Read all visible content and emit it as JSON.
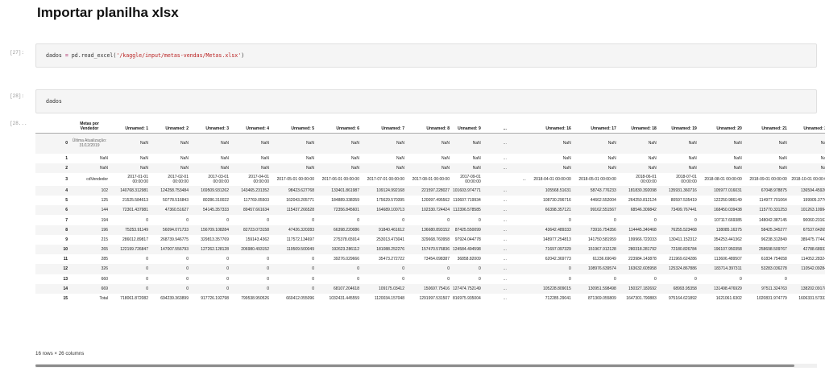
{
  "heading": "Importar planilha xlsx",
  "cells": [
    {
      "prompt": "[27]:",
      "code": {
        "var": "dados",
        "eq": " = ",
        "call": "pd.read_excel(",
        "str": "'/kaggle/input/metas-vendas/Metas.xlsx'",
        "close": ")"
      }
    },
    {
      "prompt": "[28]:",
      "code": {
        "var": "dados"
      }
    }
  ],
  "output_prompt": "[28...",
  "table": {
    "columns": [
      "Metas por Vendedor",
      "Unnamed: 1",
      "Unnamed: 2",
      "Unnamed: 3",
      "Unnamed: 4",
      "Unnamed: 5",
      "Unnamed: 6",
      "Unnamed: 7",
      "Unnamed: 8",
      "Unnamed: 9",
      "...",
      "Unnamed: 16",
      "Unnamed: 17",
      "Unnamed: 18",
      "Unnamed: 19",
      "Unnamed: 20",
      "Unnamed: 21",
      "Unnamed: 22",
      "Unnamed: 23",
      "Unnam"
    ],
    "rows": [
      {
        "idx": "0",
        "cls": "tall",
        "cells": [
          "Última Atualização: 31/12/2019",
          "NaN",
          "NaN",
          "NaN",
          "NaN",
          "NaN",
          "NaN",
          "NaN",
          "NaN",
          "NaN",
          "...",
          "NaN",
          "NaN",
          "NaN",
          "NaN",
          "NaN",
          "NaN",
          "NaN",
          "NaN",
          ""
        ]
      },
      {
        "idx": "1",
        "cls": "",
        "cells": [
          "NaN",
          "NaN",
          "NaN",
          "NaN",
          "NaN",
          "NaN",
          "NaN",
          "NaN",
          "NaN",
          "NaN",
          "...",
          "NaN",
          "NaN",
          "NaN",
          "NaN",
          "NaN",
          "NaN",
          "NaN",
          "NaN",
          ""
        ]
      },
      {
        "idx": "2",
        "cls": "",
        "cells": [
          "NaN",
          "NaN",
          "NaN",
          "NaN",
          "NaN",
          "NaN",
          "NaN",
          "NaN",
          "NaN",
          "NaN",
          "...",
          "NaN",
          "NaN",
          "NaN",
          "NaN",
          "NaN",
          "NaN",
          "NaN",
          "NaN",
          ""
        ]
      },
      {
        "idx": "3",
        "cls": "mid",
        "cells": [
          "cdVendedor",
          "2017-01-01 00:00:00",
          "2017-02-01 00:00:00",
          "2017-03-01 00:00:00",
          "2017-04-01 00:00:00",
          "2017-05-01 00:00:00",
          "2017-06-01 00:00:00",
          "2017-07-01 00:00:00",
          "2017-08-01 00:00:00",
          "2017-09-01 00:00:00",
          "...",
          "2018-04-01 00:00:00",
          "2018-05-01 00:00:00",
          "2018-06-01 00:00:00",
          "2018-07-01 00:00:00",
          "2018-08-01 00:00:00",
          "2018-09-01 00:00:00",
          "2018-10-01 00:00:00",
          "2018-11-01 00:00:00",
          "2018-"
        ]
      },
      {
        "idx": "4",
        "cls": "",
        "cells": [
          "102",
          "140768.312981",
          "124258.753484",
          "169509.931262",
          "143465.231352",
          "98423.627768",
          "133401.861987",
          "109124.992168",
          "221597.228027",
          "101603.974771",
          "...",
          "105568.51631",
          "58743.776233",
          "181830.392098",
          "135931.360716",
          "105977.016031",
          "67048.978875",
          "136594.459203",
          "39370.133088",
          "34296.9"
        ]
      },
      {
        "idx": "5",
        "cls": "",
        "cells": [
          "125",
          "21525.584613",
          "50778.516843",
          "80286.310022",
          "117769.05503",
          "162043.205771",
          "184889.338359",
          "175629.570395",
          "120097.495562",
          "110607.719934",
          "...",
          "108730.296716",
          "44662.552004",
          "264250.812124",
          "80597.535419",
          "122250.986149",
          "114977.701064",
          "199905.37762",
          "52701.549885",
          "46867.5"
        ]
      },
      {
        "idx": "6",
        "cls": "",
        "cells": [
          "144",
          "72301.437981",
          "47360.51627",
          "54145.357333",
          "89457.661634",
          "115437.266528",
          "72356.845601",
          "164689.100713",
          "102330.724424",
          "112396.578585",
          "...",
          "66398.357121",
          "99162.551567",
          "68546.309842",
          "73499.767441",
          "168450.039438",
          "115770.331253",
          "101263.109944",
          "16718.894966",
          "32769.7"
        ]
      },
      {
        "idx": "7",
        "cls": "",
        "cells": [
          "194",
          "0",
          "0",
          "0",
          "0",
          "0",
          "0",
          "0",
          "0",
          "0",
          "...",
          "0",
          "0",
          "0",
          "0",
          "107117.669385",
          "148042.387145",
          "90060.231633",
          "39364.546546",
          "43339.5"
        ]
      },
      {
        "idx": "8",
        "cls": "",
        "cells": [
          "196",
          "75253.91149",
          "56094.071733",
          "156709.108284",
          "82723.073158",
          "47426.320283",
          "66398.220086",
          "91840.461612",
          "136680.893152",
          "87425.550099",
          "...",
          "43642.489333",
          "73916.754356",
          "114445.340468",
          "76255.523468",
          "138085.16375",
          "58425.345277",
          "67537.642657",
          "10161.933261",
          "10380.6"
        ]
      },
      {
        "idx": "9",
        "cls": "",
        "cells": [
          "215",
          "286012.89817",
          "268739.946775",
          "329813.357769",
          "159143.4362",
          "117572.134697",
          "275378.65914",
          "253013.473041",
          "329668.760958",
          "97924.044778",
          "...",
          "148977.254813",
          "141750.581959",
          "199966.722033",
          "130411.152312",
          "354253.441362",
          "96238.312849",
          "389475.774425",
          "108939.167641",
          "92452.2"
        ]
      },
      {
        "idx": "10",
        "cls": "",
        "cells": [
          "265",
          "122199.726847",
          "147007.556793",
          "127262.128128",
          "206980.493152",
          "119509.500049",
          "192623.286112",
          "181088.252276",
          "157470.576836",
          "124584.494598",
          "...",
          "71697.097329",
          "151967.912128",
          "280318.281792",
          "72180.826784",
          "196107.950358",
          "258698.509767",
          "42788.689325",
          "41797.6"
        ]
      },
      {
        "idx": "11",
        "cls": "",
        "cells": [
          "285",
          "0",
          "0",
          "0",
          "0",
          "0",
          "39276.029666",
          "35473.272722",
          "73454.098387",
          "36858.82009",
          "...",
          "62042.369773",
          "61236.69049",
          "223984.143878",
          "211969.624286",
          "113606.489507",
          "61834.754658",
          "114052.283242",
          "103479.87102",
          "31620.1"
        ]
      },
      {
        "idx": "12",
        "cls": "",
        "cells": [
          "326",
          "0",
          "0",
          "0",
          "0",
          "0",
          "0",
          "0",
          "0",
          "0",
          "...",
          "0",
          "108976.639574",
          "163632.605958",
          "125324.867886",
          "183714.397311",
          "53283.036278",
          "110542.092849",
          "80017.020901",
          "56449.8"
        ]
      },
      {
        "idx": "13",
        "cls": "",
        "cells": [
          "660",
          "0",
          "0",
          "0",
          "0",
          "0",
          "0",
          "0",
          "0",
          "0",
          "...",
          "0",
          "0",
          "0",
          "0",
          "0",
          "0",
          "0",
          "28839.044051",
          "18374.3"
        ]
      },
      {
        "idx": "14",
        "cls": "",
        "cells": [
          "669",
          "0",
          "0",
          "0",
          "0",
          "0",
          "68107.204618",
          "109175.03412",
          "150697.75416",
          "127474.752149",
          "...",
          "105228.809015",
          "130951.598498",
          "150327.182692",
          "68993.95358",
          "131498.476929",
          "97511.324763",
          "138202.091783",
          "34952.883908",
          "28028.7"
        ]
      },
      {
        "idx": "15",
        "cls": "",
        "cells": [
          "Total",
          "718061.872082",
          "694239.363899",
          "917726.192798",
          "799538.950526",
          "660412.055096",
          "1032431.445559",
          "1120034.157048",
          "1291997.531507",
          "816975.935004",
          "...",
          "712285.29041",
          "871369.055809",
          "1647301.790883",
          "975164.621892",
          "1621061.6302",
          "1020831.974779",
          "1606331.573323",
          "557333.734593",
          "436377.5"
        ]
      }
    ]
  },
  "summary": "16 rows × 26 columns"
}
